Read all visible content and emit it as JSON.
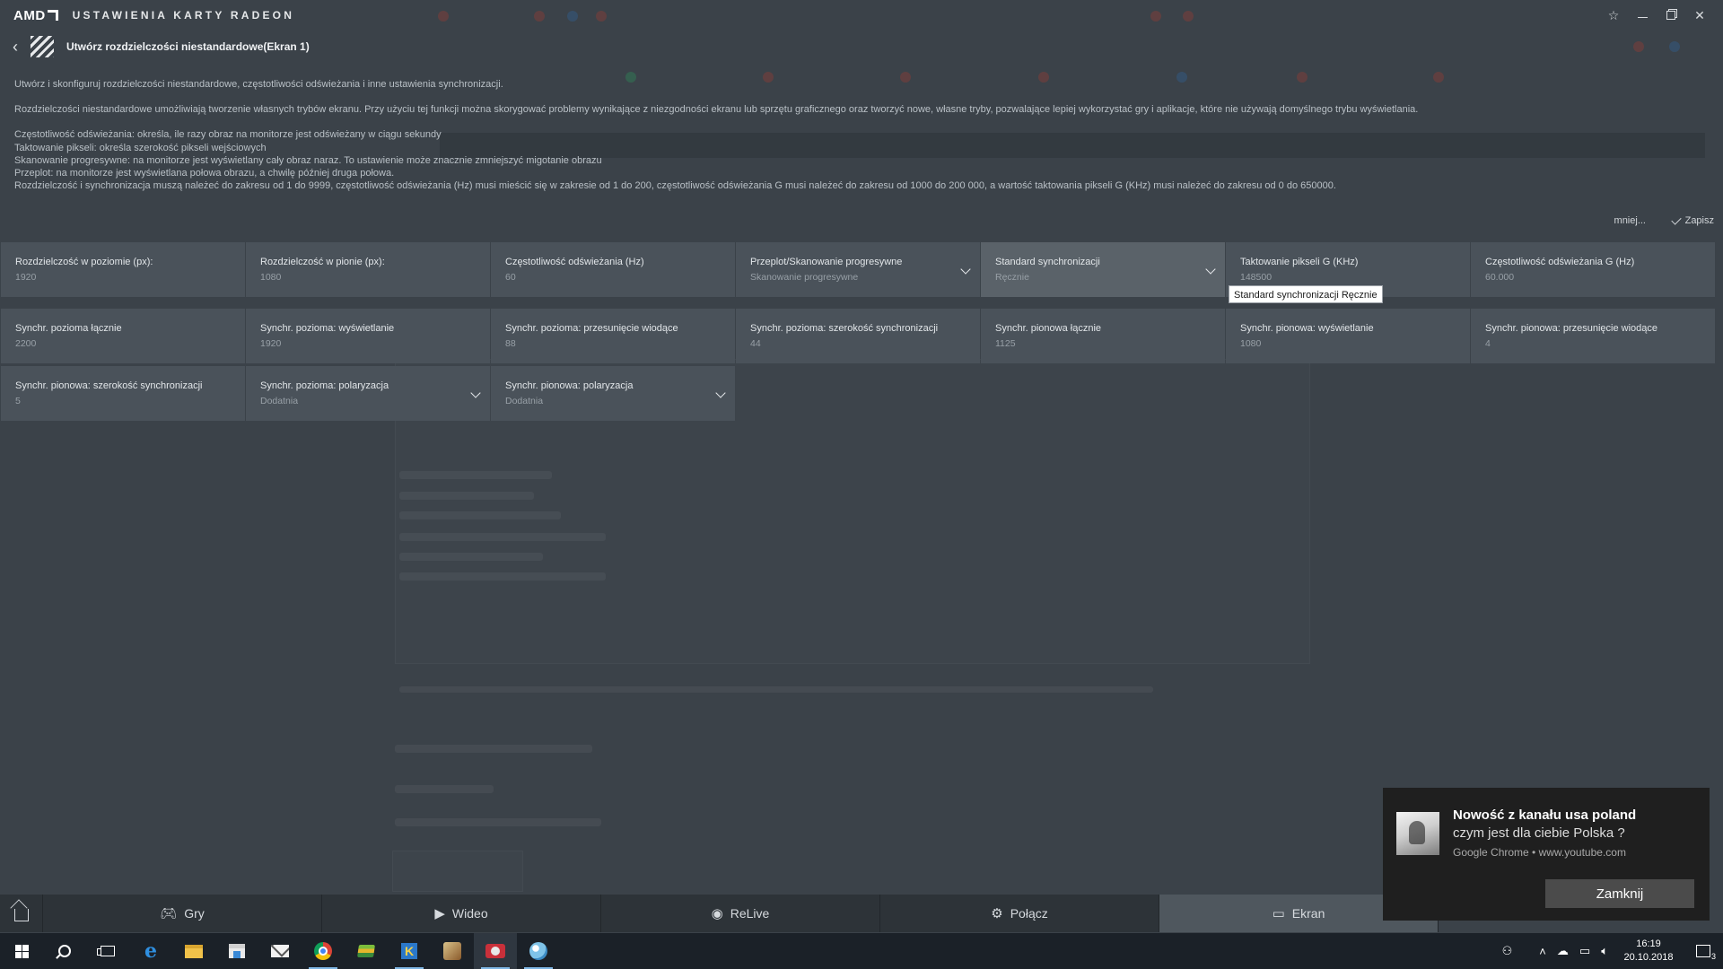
{
  "app": {
    "logo": "AMD",
    "title": "USTAWIENIA KARTY RADEON"
  },
  "page": {
    "title": "Utwórz rozdzielczości niestandardowe(Ekran 1)",
    "intro": "Utwórz i skonfiguruj rozdzielczości niestandardowe, częstotliwości odświeżania i inne ustawienia synchronizacji.",
    "paragraph": "Rozdzielczości niestandardowe umożliwiają tworzenie własnych trybów ekranu. Przy użyciu tej funkcji można skorygować problemy wynikające z niezgodności ekranu lub sprzętu graficznego oraz tworzyć nowe, własne tryby, pozwalające lepiej wykorzystać gry i aplikacje, które nie używają domyślnego trybu wyświetlania.",
    "notes": [
      "Częstotliwość odświeżania: określa, ile razy obraz na monitorze jest odświeżany w ciągu sekundy",
      "Taktowanie pikseli: określa szerokość pikseli wejściowych",
      "Skanowanie progresywne: na monitorze jest wyświetlany cały obraz naraz. To ustawienie może znacznie zmniejszyć migotanie obrazu",
      "Przeplot: na monitorze jest wyświetlana połowa obrazu, a chwilę później druga połowa.",
      "Rozdzielczość i synchronizacja muszą należeć do zakresu od 1 do 9999, częstotliwość odświeżania (Hz) musi mieścić się w zakresie od 1 do 200, częstotliwość odświeżania G musi należeć do zakresu od 1000 do 200 000, a wartość taktowania pikseli G (KHz) musi należeć do zakresu od 0 do 650000."
    ],
    "less_label": "mniej...",
    "save_label": "Zapisz"
  },
  "fields": {
    "row1": [
      {
        "label": "Rozdzielczość w poziomie (px):",
        "value": "1920"
      },
      {
        "label": "Rozdzielczość w pionie (px):",
        "value": "1080"
      },
      {
        "label": "Częstotliwość odświeżania (Hz)",
        "value": "60"
      },
      {
        "label": "Przeplot/Skanowanie progresywne",
        "value": "Skanowanie progresywne"
      },
      {
        "label": "Standard synchronizacji",
        "value": "Ręcznie"
      },
      {
        "label": "Taktowanie pikseli G (KHz)",
        "value": "148500"
      },
      {
        "label": "Częstotliwość odświeżania G (Hz)",
        "value": "60.000"
      }
    ],
    "row2": [
      {
        "label": "Synchr. pozioma łącznie",
        "value": "2200"
      },
      {
        "label": "Synchr. pozioma: wyświetlanie",
        "value": "1920"
      },
      {
        "label": "Synchr. pozioma: przesunięcie wiodące",
        "value": "88"
      },
      {
        "label": "Synchr. pozioma: szerokość synchronizacji",
        "value": "44"
      },
      {
        "label": "Synchr. pionowa łącznie",
        "value": "1125"
      },
      {
        "label": "Synchr. pionowa: wyświetlanie",
        "value": "1080"
      },
      {
        "label": "Synchr. pionowa: przesunięcie wiodące",
        "value": "4"
      }
    ],
    "row3": [
      {
        "label": "Synchr. pionowa: szerokość synchronizacji",
        "value": "5"
      },
      {
        "label": "Synchr. pozioma: polaryzacja",
        "value": "Dodatnia"
      },
      {
        "label": "Synchr. pionowa: polaryzacja",
        "value": "Dodatnia"
      }
    ]
  },
  "tooltip": "Standard synchronizacji Ręcznie",
  "nav": {
    "tabs": [
      {
        "label": "Gry",
        "icon": "gamepad-icon"
      },
      {
        "label": "Wideo",
        "icon": "play-icon"
      },
      {
        "label": "ReLive",
        "icon": "relive-icon"
      },
      {
        "label": "Połącz",
        "icon": "connect-icon"
      },
      {
        "label": "Ekran",
        "icon": "monitor-icon"
      }
    ]
  },
  "notification": {
    "title": "Nowość z kanału usa poland",
    "message": "czym jest dla ciebie Polska ?",
    "source": "Google Chrome • www.youtube.com",
    "close_label": "Zamknij"
  },
  "taskbar": {
    "time": "16:19",
    "date": "20.10.2018",
    "notification_count": "3"
  },
  "colors": {
    "background": "#3b4249",
    "field": "#4a525a",
    "field_highlight": "#5a6269",
    "nav": "#2d3338",
    "taskbar": "#1b2128",
    "toast": "#1f1f1f"
  }
}
